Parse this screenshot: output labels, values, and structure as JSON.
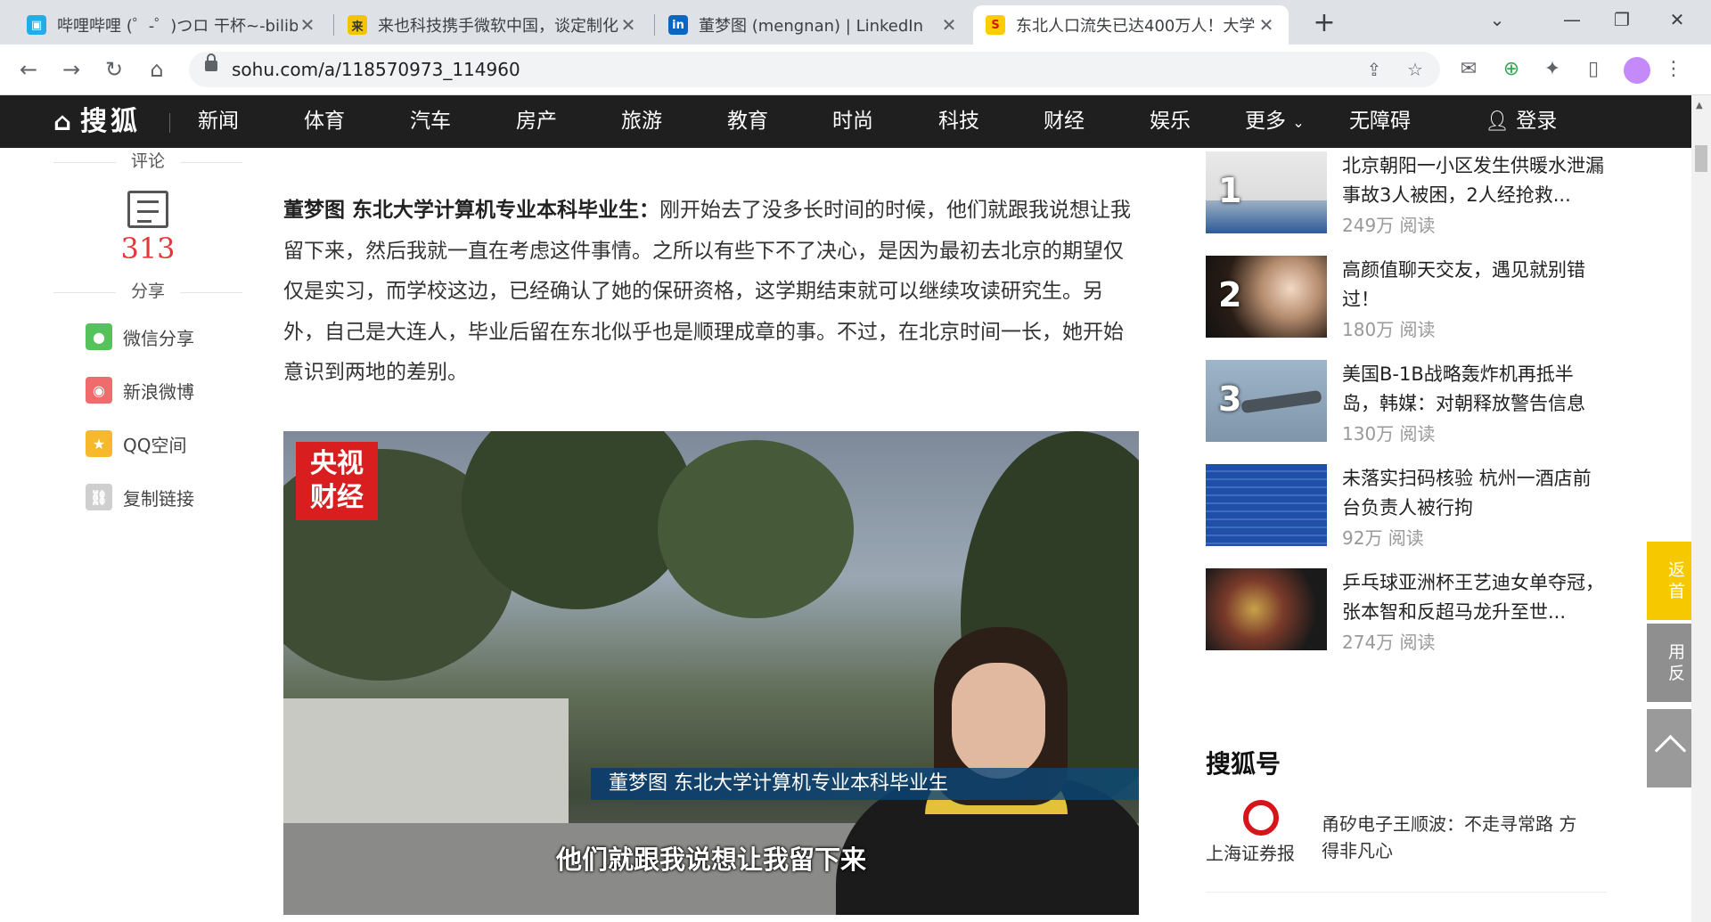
{
  "browser": {
    "tabs": [
      {
        "title": "哔哩哔哩 (゜-゜)つロ 干杯~-bilibili",
        "favicon": "bilibili-icon",
        "color": "#23ade5",
        "active": false
      },
      {
        "title": "来也科技携手微软中国，谈定制化",
        "favicon": "laiye-icon",
        "color": "#f5c400",
        "active": false
      },
      {
        "title": "董梦图 (mengnan) | LinkedIn",
        "favicon": "linkedin-icon",
        "color": "#0a66c2",
        "active": false
      },
      {
        "title": "东北人口流失已达400万人！大学",
        "favicon": "sohu-icon",
        "color": "#ffcc00",
        "active": true
      }
    ],
    "url": "sohu.com/a/118570973_114960"
  },
  "nav": {
    "logo": "搜狐",
    "items": [
      "新闻",
      "体育",
      "汽车",
      "房产",
      "旅游",
      "教育",
      "时尚",
      "科技",
      "财经",
      "娱乐",
      "更多",
      "无障碍"
    ],
    "login": "登录"
  },
  "side": {
    "comment_label": "评论",
    "comment_count": "313",
    "share_label": "分享",
    "share_items": [
      {
        "label": "微信分享",
        "icon": "wechat-icon",
        "color": "#56c25c"
      },
      {
        "label": "新浪微博",
        "icon": "weibo-icon",
        "color": "#f06b6b"
      },
      {
        "label": "QQ空间",
        "icon": "qzone-icon",
        "color": "#f7b92c"
      },
      {
        "label": "复制链接",
        "icon": "link-icon",
        "color": "#cfcfcf"
      }
    ]
  },
  "article": {
    "speaker": "董梦图 东北大学计算机专业本科毕业生：",
    "body": "刚开始去了没多长时间的时候，他们就跟我说想让我留下来，然后我就一直在考虑这件事情。之所以有些下不了决心，是因为最初去北京的期望仅仅是实习，而学校这边，已经确认了她的保研资格，这学期结束就可以继续攻读研究生。另外，自己是大连人，毕业后留在东北似乎也是顺理成章的事。不过，在北京时间一长，她开始意识到两地的差别。"
  },
  "video": {
    "logo_line1": "央视",
    "logo_line2": "财经",
    "caption": "董梦图  东北大学计算机专业本科毕业生",
    "subtitle": "他们就跟我说想让我留下来"
  },
  "rank": [
    {
      "num": "1",
      "title": "北京朝阳一小区发生供暖水泄漏事故3人被困，2人经抢救...",
      "reads": "249万 阅读"
    },
    {
      "num": "2",
      "title": "高颜值聊天交友，遇见就别错过！",
      "reads": "180万 阅读"
    },
    {
      "num": "3",
      "title": "美国B-1B战略轰炸机再抵半岛，韩媒：对朝释放警告信息",
      "reads": "130万 阅读"
    },
    {
      "num": "",
      "title": "未落实扫码核验 杭州一酒店前台负责人被行拘",
      "reads": "92万 阅读"
    },
    {
      "num": "",
      "title": "乒乓球亚洲杯王艺迪女单夺冠，张本智和反超马龙升至世...",
      "reads": "274万 阅读"
    }
  ],
  "souhuhao": {
    "heading": "搜狐号",
    "media_name": "上海证券报",
    "media_title": "甬矽电子王顺波：不走寻常路 方得非凡心"
  },
  "float": {
    "back_home": "返\n首",
    "feedback": "用\n反"
  }
}
